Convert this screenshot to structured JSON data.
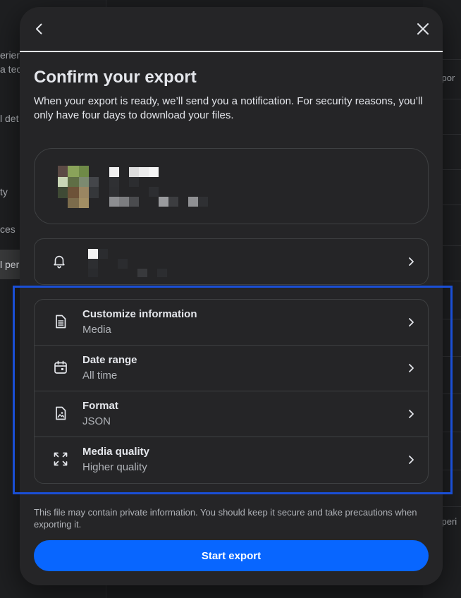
{
  "background": {
    "left_items": [
      "erien",
      "a tec",
      "l det",
      "ty",
      "ces",
      "l per"
    ],
    "right_items": [
      "xpor",
      "xperi"
    ]
  },
  "modal": {
    "back_icon": "chevron-left-icon",
    "close_icon": "close-icon",
    "title": "Confirm your export",
    "description": "When your export is ready, we’ll send you a notification. For security reasons, you’ll only have four days to download your files.",
    "notification_icon": "bell-icon",
    "options": [
      {
        "icon": "document-list-icon",
        "title": "Customize information",
        "value": "Media"
      },
      {
        "icon": "calendar-icon",
        "title": "Date range",
        "value": "All time"
      },
      {
        "icon": "image-file-icon",
        "title": "Format",
        "value": "JSON"
      },
      {
        "icon": "expand-arrows-icon",
        "title": "Media quality",
        "value": "Higher quality"
      }
    ],
    "footnote": "This file may contain private information. You should keep it secure and take precautions when exporting it.",
    "start_button": "Start export"
  },
  "colors": {
    "modal_bg": "#252527",
    "accent": "#0866ff",
    "highlight": "#1a4fd6",
    "text_primary": "#e4e6eb",
    "text_secondary": "#b0b3b8"
  }
}
